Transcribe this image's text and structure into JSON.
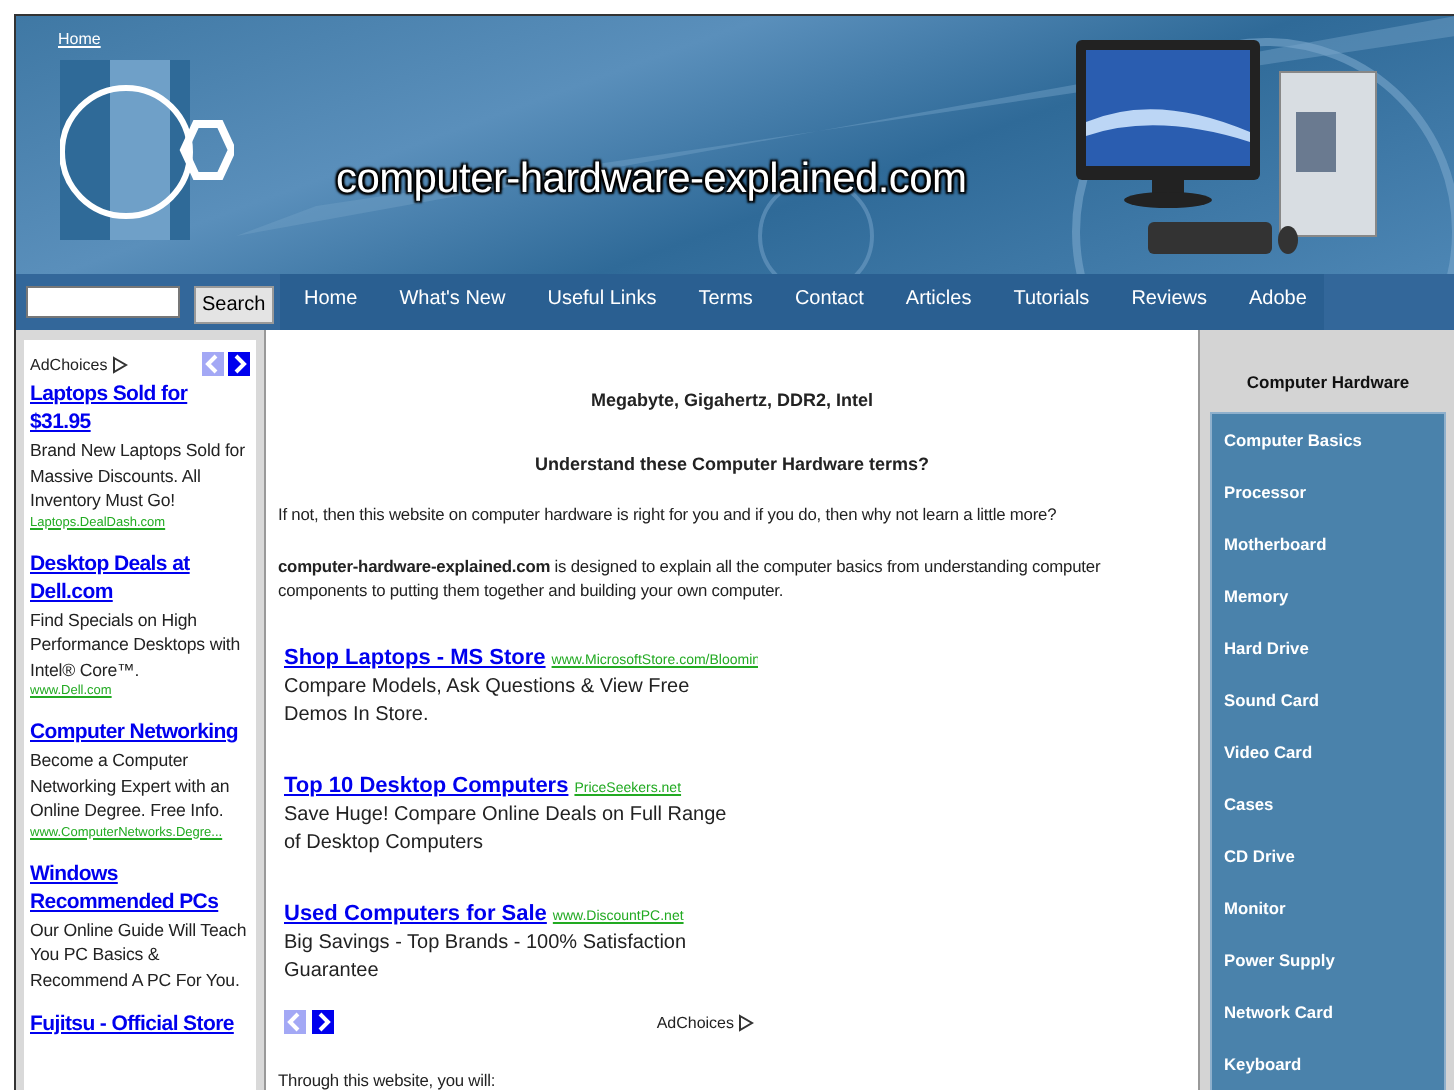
{
  "header": {
    "home_link": "Home",
    "site_title": "computer-hardware-explained.com"
  },
  "search": {
    "button": "Search"
  },
  "nav": [
    "Home",
    "What's New",
    "Useful Links",
    "Terms",
    "Contact",
    "Articles",
    "Tutorials",
    "Reviews",
    "Adobe"
  ],
  "left_ads": {
    "adchoices": "AdChoices",
    "pager": [
      {
        "kind": "prev",
        "disabled": true
      },
      {
        "kind": "next",
        "disabled": false
      }
    ],
    "ads": [
      {
        "title": "Laptops Sold for $31.95",
        "text": "Brand New Laptops Sold for Massive Discounts. All Inventory Must Go!",
        "url": "Laptops.DealDash.com"
      },
      {
        "title": "Desktop Deals at Dell.com",
        "text": "Find Specials on High Performance Desktops with Intel® Core™.",
        "url": "www.Dell.com"
      },
      {
        "title": "Computer Networking",
        "text": "Become a Computer Networking Expert with an Online Degree. Free Info.",
        "url": "www.ComputerNetworks.Degre..."
      },
      {
        "title": "Windows Recommended PCs",
        "text": "Our Online Guide Will Teach You PC Basics & Recommend A PC For You."
      },
      {
        "title": "Fujitsu - Official Store"
      }
    ]
  },
  "main": {
    "heading_1": "Megabyte, Gigahertz, DDR2, Intel",
    "heading_2": "Understand these Computer Hardware terms?",
    "paragraphs": [
      "If not, then this website on computer hardware is right for you and if you do, then why not learn a little more?",
      "**computer-hardware-explained.com** is designed to explain all the computer basics from understanding computer components to putting them together and building your own computer."
    ],
    "ads": [
      {
        "title": "Shop Laptops - MS Store",
        "url": "www.MicrosoftStore.com/Bloomin",
        "text": "Compare Models, Ask Questions & View Free Demos In Store."
      },
      {
        "title": "Top 10 Desktop Computers",
        "url": "PriceSeekers.net",
        "text": "Save Huge! Compare Online Deals on Full Range of Desktop Computers"
      },
      {
        "title": "Used Computers for Sale",
        "url": "www.DiscountPC.net",
        "text": "Big Savings - Top Brands - 100% Satisfaction Guarantee"
      }
    ],
    "pager": [
      {
        "kind": "prev",
        "disabled": true
      },
      {
        "kind": "next",
        "disabled": false
      }
    ],
    "adchoices": "AdChoices",
    "closing": "Through this website, you will:"
  },
  "sidebar": {
    "title": "Computer Hardware",
    "items": [
      "Computer Basics",
      "Processor",
      "Motherboard",
      "Memory",
      "Hard Drive",
      "Sound Card",
      "Video Card",
      "Cases",
      "CD Drive",
      "Monitor",
      "Power Supply",
      "Network Card",
      "Keyboard"
    ]
  }
}
